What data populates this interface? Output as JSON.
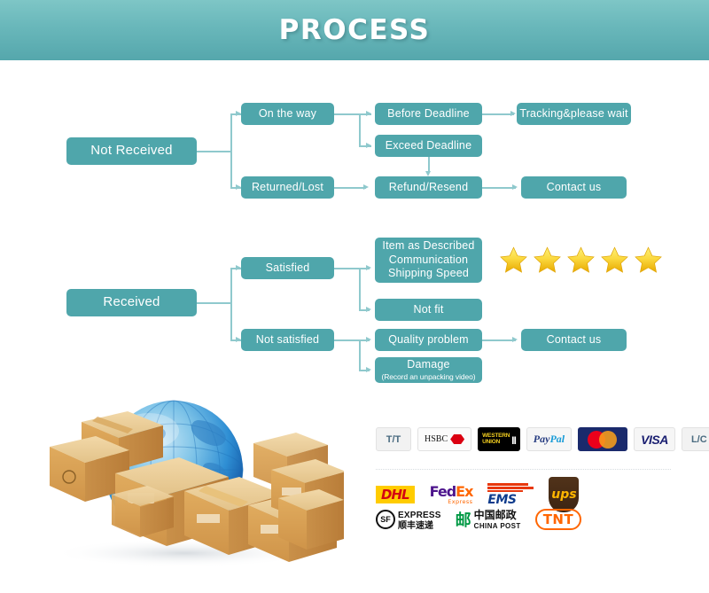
{
  "header": {
    "title": "PROCESS"
  },
  "flow_not_received": {
    "root": "Not Received",
    "branch_top": "On the way",
    "branch_bottom": "Returned/Lost",
    "before_deadline": "Before Deadline",
    "exceed_deadline": "Exceed Deadline",
    "refund_resend": "Refund/Resend",
    "tracking": "Tracking&please wait",
    "contact_us": "Contact us"
  },
  "flow_received": {
    "root": "Received",
    "branch_top": "Satisfied",
    "branch_bottom": "Not satisfied",
    "rating_line1": "Item as Described",
    "rating_line2": "Communication",
    "rating_line3": "Shipping Speed",
    "not_fit": "Not fit",
    "quality_problem": "Quality problem",
    "damage_title": "Damage",
    "damage_note": "(Record an unpacking video)",
    "contact_us": "Contact us",
    "stars_count": 5,
    "star_color": "#f6c700"
  },
  "artwork": {
    "name": "globe-with-shipping-boxes"
  },
  "payments": [
    {
      "name": "tt",
      "label": "T/T"
    },
    {
      "name": "hsbc",
      "label": "HSBC"
    },
    {
      "name": "western-union",
      "label_1": "WESTERN",
      "label_2": "UNION"
    },
    {
      "name": "paypal",
      "label_a": "Pay",
      "label_b": "Pal"
    },
    {
      "name": "mastercard",
      "label": "MasterCard"
    },
    {
      "name": "visa",
      "label": "VISA"
    },
    {
      "name": "lc",
      "label": "L/C"
    }
  ],
  "shipping_top": [
    {
      "name": "dhl",
      "label": "DHL"
    },
    {
      "name": "fedex",
      "label_a": "Fed",
      "label_b": "Ex",
      "sub": "Express"
    },
    {
      "name": "ems",
      "label": "EMS"
    },
    {
      "name": "ups",
      "label": "ups"
    }
  ],
  "shipping_bottom": [
    {
      "name": "sf-express",
      "badge": "SF",
      "label_en": "EXPRESS",
      "label_cn": "顺丰速递"
    },
    {
      "name": "china-post",
      "label_cn": "中国邮政",
      "label_en": "CHINA POST"
    },
    {
      "name": "tnt",
      "label": "TNT"
    }
  ],
  "colors": {
    "header_top": "#7ec6c6",
    "header_bottom": "#55a7ac",
    "box": "#4fa6ab",
    "connector": "#8fc9cd"
  }
}
